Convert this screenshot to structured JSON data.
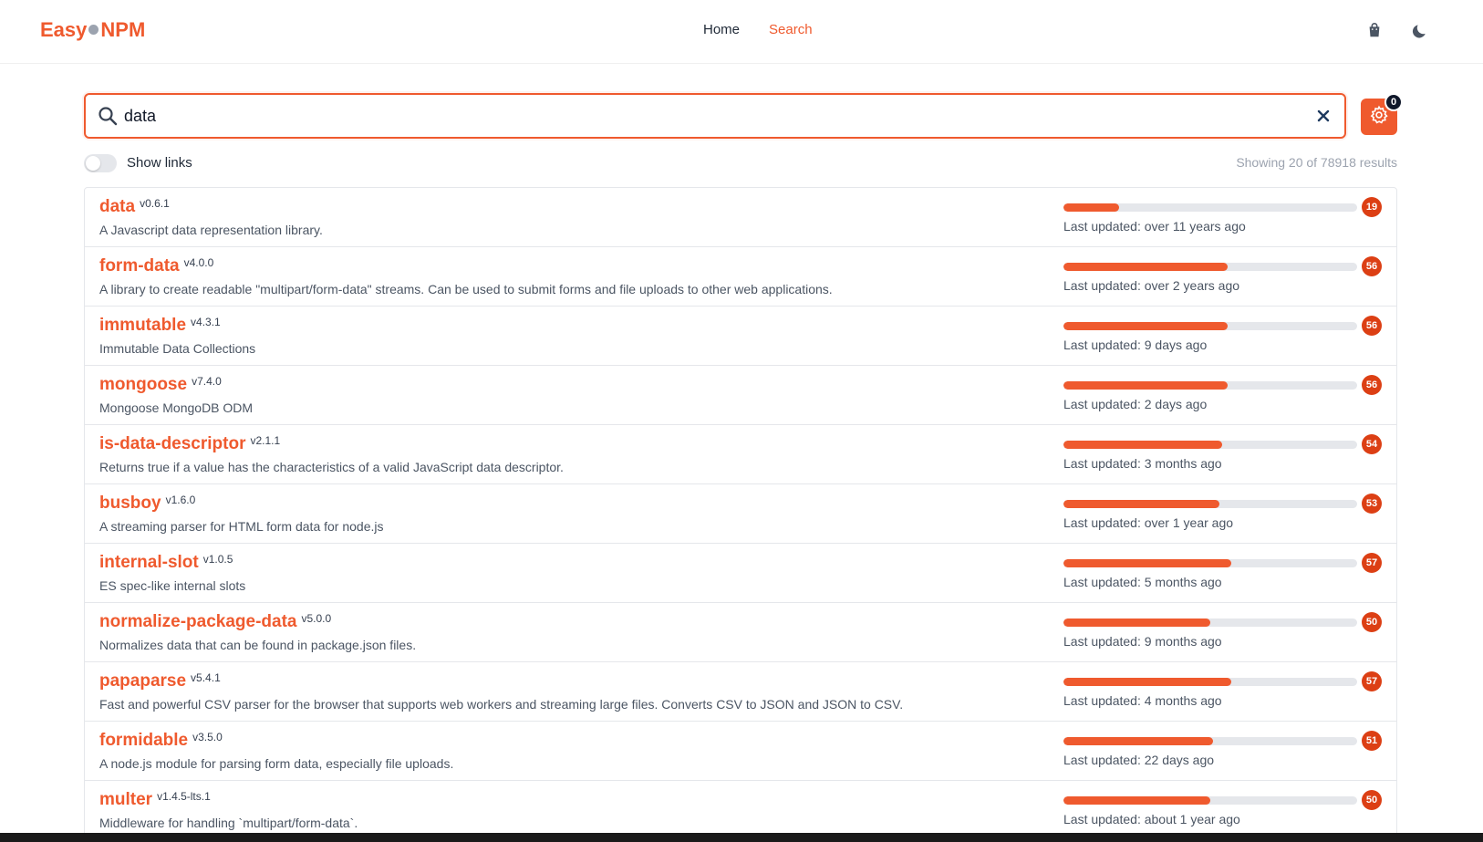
{
  "app": {
    "logo_left": "Easy",
    "logo_right": "NPM"
  },
  "nav": {
    "home": "Home",
    "search": "Search"
  },
  "header_icons": [
    "bag-icon",
    "moon-icon"
  ],
  "search": {
    "value": "data",
    "placeholder": ""
  },
  "settings": {
    "badge": "0"
  },
  "toggle": {
    "label": "Show links",
    "on": false
  },
  "results_summary": "Showing 20 of 78918 results",
  "colors": {
    "accent": "#ef5a2e",
    "badge": "#dc3f14"
  },
  "results": [
    {
      "name": "data",
      "version": "v0.6.1",
      "description": "A Javascript data representation library.",
      "score": "19",
      "updated": "Last updated: over 11 years ago"
    },
    {
      "name": "form-data",
      "version": "v4.0.0",
      "description": "A library to create readable \"multipart/form-data\" streams. Can be used to submit forms and file uploads to other web applications.",
      "score": "56",
      "updated": "Last updated: over 2 years ago"
    },
    {
      "name": "immutable",
      "version": "v4.3.1",
      "description": "Immutable Data Collections",
      "score": "56",
      "updated": "Last updated: 9 days ago"
    },
    {
      "name": "mongoose",
      "version": "v7.4.0",
      "description": "Mongoose MongoDB ODM",
      "score": "56",
      "updated": "Last updated: 2 days ago"
    },
    {
      "name": "is-data-descriptor",
      "version": "v2.1.1",
      "description": "Returns true if a value has the characteristics of a valid JavaScript data descriptor.",
      "score": "54",
      "updated": "Last updated: 3 months ago"
    },
    {
      "name": "busboy",
      "version": "v1.6.0",
      "description": "A streaming parser for HTML form data for node.js",
      "score": "53",
      "updated": "Last updated: over 1 year ago"
    },
    {
      "name": "internal-slot",
      "version": "v1.0.5",
      "description": "ES spec-like internal slots",
      "score": "57",
      "updated": "Last updated: 5 months ago"
    },
    {
      "name": "normalize-package-data",
      "version": "v5.0.0",
      "description": "Normalizes data that can be found in package.json files.",
      "score": "50",
      "updated": "Last updated: 9 months ago"
    },
    {
      "name": "papaparse",
      "version": "v5.4.1",
      "description": "Fast and powerful CSV parser for the browser that supports web workers and streaming large files. Converts CSV to JSON and JSON to CSV.",
      "score": "57",
      "updated": "Last updated: 4 months ago"
    },
    {
      "name": "formidable",
      "version": "v3.5.0",
      "description": "A node.js module for parsing form data, especially file uploads.",
      "score": "51",
      "updated": "Last updated: 22 days ago"
    },
    {
      "name": "multer",
      "version": "v1.4.5-lts.1",
      "description": "Middleware for handling `multipart/form-data`.",
      "score": "50",
      "updated": "Last updated: about 1 year ago"
    }
  ]
}
